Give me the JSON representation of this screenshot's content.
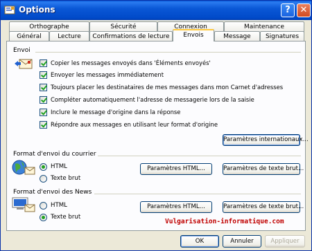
{
  "window": {
    "title": "Options"
  },
  "titlebar": {
    "help_glyph": "?",
    "close_glyph": "✕"
  },
  "tabs_row1": [
    "Orthographe",
    "Sécurité",
    "Connexion",
    "Maintenance"
  ],
  "tabs_row2": [
    "Général",
    "Lecture",
    "Confirmations de lecture",
    "Envois",
    "Message",
    "Signatures"
  ],
  "active_tab": "Envois",
  "envoi": {
    "label": "Envoi",
    "checkboxes": [
      {
        "label": "Copier les messages envoyés dans 'Éléments envoyés'",
        "checked": true
      },
      {
        "label": "Envoyer les messages immédiatement",
        "checked": true
      },
      {
        "label": "Toujours placer les destinataires de mes messages dans mon Carnet d'adresses",
        "checked": true
      },
      {
        "label": "Compléter automatiquement l'adresse de messagerie lors de la saisie",
        "checked": true
      },
      {
        "label": "Inclure le message d'origine dans la réponse",
        "checked": true
      },
      {
        "label": "Répondre aux messages en utilisant leur format d'origine",
        "checked": true
      }
    ],
    "intl_button": "Paramètres internationaux..."
  },
  "mail_format": {
    "label": "Format d'envoi du courrier",
    "html": "HTML",
    "plain": "Texte brut",
    "selected": "HTML",
    "html_settings": "Paramètres HTML...",
    "plain_settings": "Paramètres de texte brut..."
  },
  "news_format": {
    "label": "Format d'envoi des News",
    "html": "HTML",
    "plain": "Texte brut",
    "selected": "Texte brut",
    "html_settings": "Paramètres HTML...",
    "plain_settings": "Paramètres de texte brut..."
  },
  "watermark": "Vulgarisation-informatique.com",
  "footer": {
    "ok": "OK",
    "cancel": "Annuler",
    "apply": "Appliquer"
  },
  "colors": {
    "titlebar": "#0a58d6",
    "tab_highlight": "#ffc83c",
    "check": "#21a121",
    "watermark": "#c00000"
  }
}
